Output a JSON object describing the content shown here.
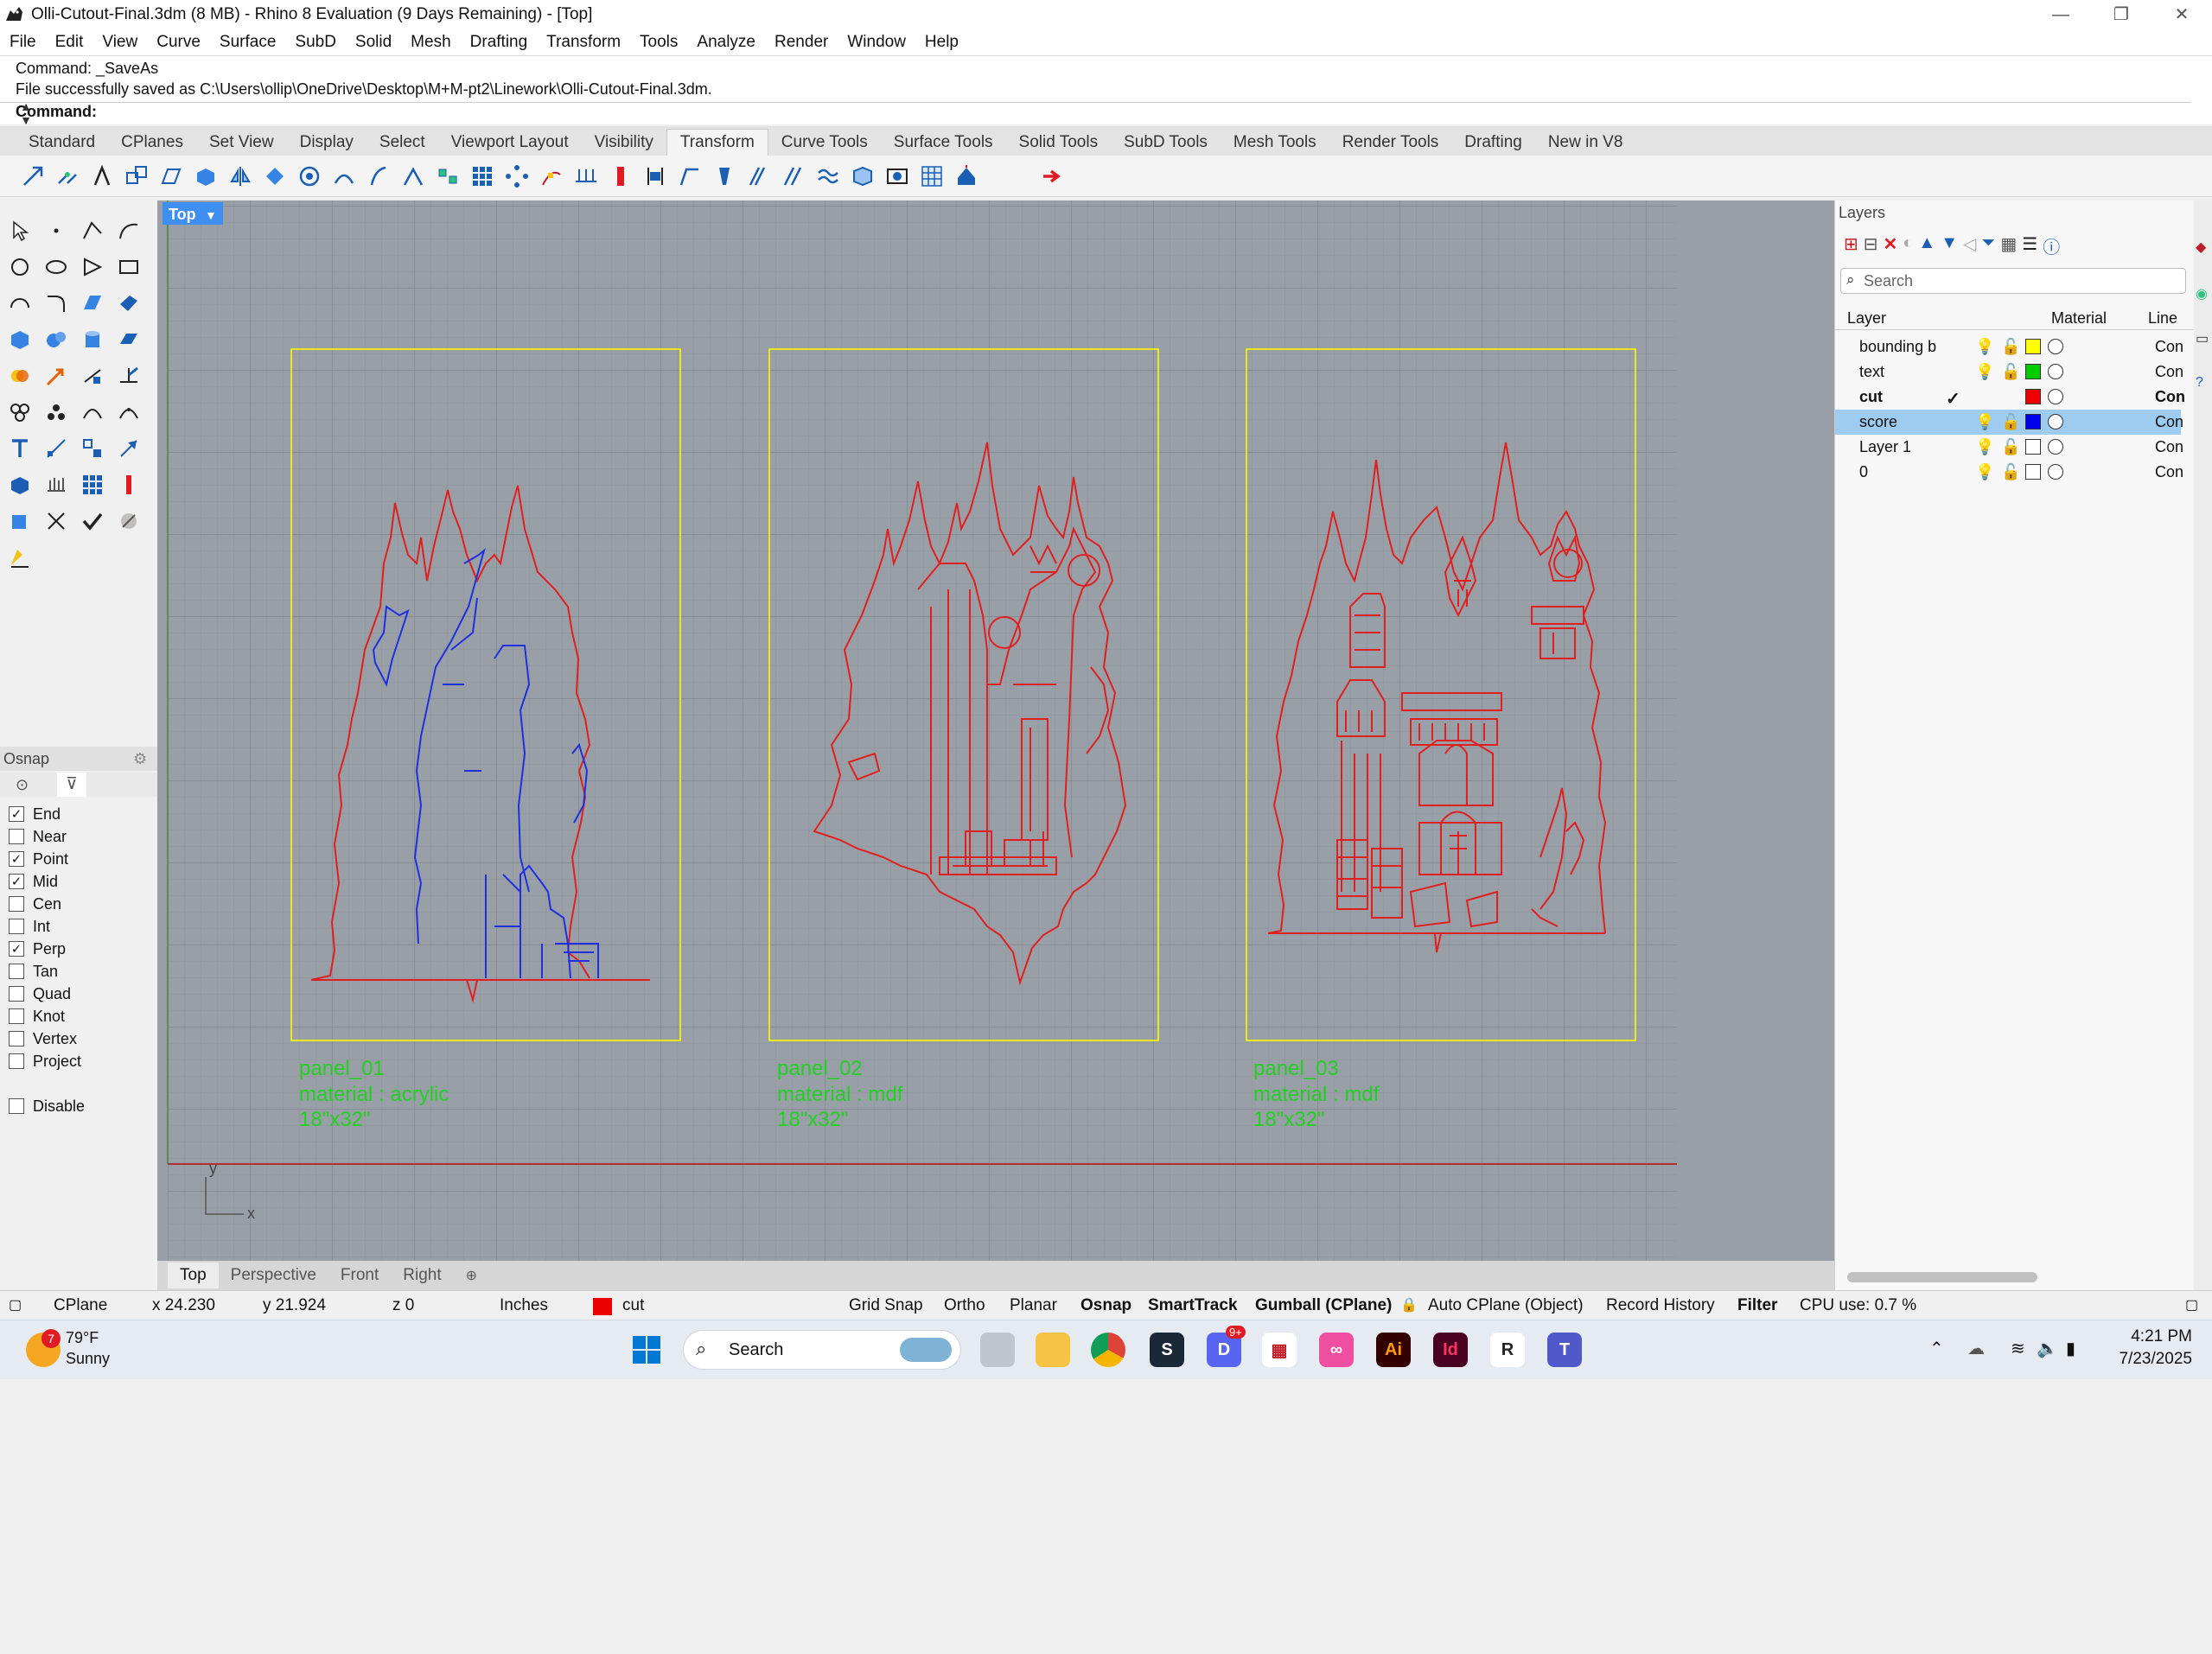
{
  "window": {
    "title": "Olli-Cutout-Final.3dm (8 MB) - Rhino 8 Evaluation (9 Days Remaining) - [Top]",
    "minimize": "—",
    "restore": "❐",
    "close": "✕"
  },
  "menu": [
    "File",
    "Edit",
    "View",
    "Curve",
    "Surface",
    "SubD",
    "Solid",
    "Mesh",
    "Drafting",
    "Transform",
    "Tools",
    "Analyze",
    "Render",
    "Window",
    "Help"
  ],
  "command": {
    "history1": "Command: _SaveAs",
    "history2": "File successfully saved as C:\\Users\\ollip\\OneDrive\\Desktop\\M+M-pt2\\Linework\\Olli-Cutout-Final.3dm.",
    "prompt": "Command:"
  },
  "toolbar_tabs": [
    "Standard",
    "CPlanes",
    "Set View",
    "Display",
    "Select",
    "Viewport Layout",
    "Visibility",
    "Transform",
    "Curve Tools",
    "Surface Tools",
    "Solid Tools",
    "SubD Tools",
    "Mesh Tools",
    "Render Tools",
    "Drafting",
    "New in V8"
  ],
  "active_tab": "Transform",
  "viewport": {
    "name": "Top",
    "axis_y": "y",
    "axis_x": "x",
    "panels": [
      {
        "name": "panel_01",
        "material": "material : acrylic",
        "size": "18\"x32\""
      },
      {
        "name": "panel_02",
        "material": "material : mdf",
        "size": "18\"x32\""
      },
      {
        "name": "panel_03",
        "material": "material : mdf",
        "size": "18\"x32\""
      }
    ]
  },
  "viewport_tabs": [
    "Top",
    "Perspective",
    "Front",
    "Right"
  ],
  "osnap": {
    "title": "Osnap",
    "items": [
      {
        "label": "End",
        "checked": true
      },
      {
        "label": "Near",
        "checked": false
      },
      {
        "label": "Point",
        "checked": true
      },
      {
        "label": "Mid",
        "checked": true
      },
      {
        "label": "Cen",
        "checked": false
      },
      {
        "label": "Int",
        "checked": false
      },
      {
        "label": "Perp",
        "checked": true
      },
      {
        "label": "Tan",
        "checked": false
      },
      {
        "label": "Quad",
        "checked": false
      },
      {
        "label": "Knot",
        "checked": false
      },
      {
        "label": "Vertex",
        "checked": false
      },
      {
        "label": "Project",
        "checked": false
      }
    ],
    "disable": "Disable"
  },
  "layers": {
    "title": "Layers",
    "search_placeholder": "Search",
    "col_layer": "Layer",
    "col_material": "Material",
    "col_linetype": "Line",
    "rows": [
      {
        "name": "bounding b",
        "color": "#ffff00",
        "linetype": "Con",
        "current": false,
        "selected": false
      },
      {
        "name": "text",
        "color": "#00cc00",
        "linetype": "Con",
        "current": false,
        "selected": false
      },
      {
        "name": "cut",
        "color": "#ee0000",
        "linetype": "Con",
        "current": true,
        "selected": false
      },
      {
        "name": "score",
        "color": "#0000ee",
        "linetype": "Con",
        "current": false,
        "selected": true
      },
      {
        "name": "Layer 1",
        "color": "#ffffff",
        "linetype": "Con",
        "current": false,
        "selected": false
      },
      {
        "name": "0",
        "color": "#ffffff",
        "linetype": "Con",
        "current": false,
        "selected": false
      }
    ],
    "current_mark": "✓"
  },
  "status": {
    "cplane": "CPlane",
    "x": "x 24.230",
    "y": "y 21.924",
    "z": "z 0",
    "units": "Inches",
    "layer": "cut",
    "layer_color": "#ee0000",
    "grid_snap": "Grid Snap",
    "ortho": "Ortho",
    "planar": "Planar",
    "osnap": "Osnap",
    "smarttrack": "SmartTrack",
    "gumball": "Gumball (CPlane)",
    "autocplane": "Auto CPlane (Object)",
    "record": "Record History",
    "filter": "Filter",
    "cpu": "CPU use: 0.7 %"
  },
  "taskbar": {
    "weather_temp": "79°F",
    "weather_cond": "Sunny",
    "weather_badge": "7",
    "search": "Search",
    "discord_badge": "9+",
    "time": "4:21 PM",
    "date": "7/23/2025"
  }
}
